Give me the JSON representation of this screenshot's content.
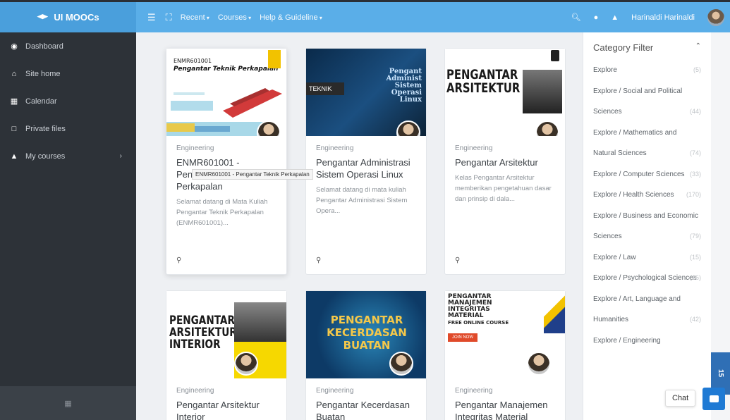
{
  "topbar": {
    "brand": "UI MOOCs",
    "menu": [
      "Recent",
      "Courses",
      "Help & Guideline"
    ],
    "user_name": "Harinaldi Harinaldi"
  },
  "sidebar": {
    "items": [
      {
        "label": "Dashboard",
        "icon": "dashboard-icon"
      },
      {
        "label": "Site home",
        "icon": "home-icon"
      },
      {
        "label": "Calendar",
        "icon": "calendar-icon"
      },
      {
        "label": "Private files",
        "icon": "file-icon"
      },
      {
        "label": "My courses",
        "icon": "graduation-cap-icon"
      }
    ]
  },
  "courses": [
    {
      "category": "Engineering",
      "title": "ENMR601001 - Pengantar Teknik Perkapalan",
      "desc": "Selamat datang di Mata Kuliah Pengantar Teknik Perkapalan (ENMR601001)...",
      "img_code": "ENMR601001",
      "img_title": "Pengantar Teknik Perkapalan"
    },
    {
      "category": "Engineering",
      "title": "Pengantar Administrasi Sistem Operasi Linux",
      "desc": "Selamat datang di mata kuliah Pengantar Administrasi Sistem Opera...",
      "img_label": "TEKNIK",
      "img_title": "Pengant Administ Sistem Operasi Linux"
    },
    {
      "category": "Engineering",
      "title": "Pengantar Arsitektur",
      "desc": "Kelas Pengantar Arsitektur memberikan pengetahuan dasar dan prinsip di dala...",
      "img_title": "PENGANTAR ARSITEKTUR"
    },
    {
      "category": "Engineering",
      "title": "Pengantar Arsitektur Interior",
      "img_title": "PENGANTAR ARSITEKTUR INTERIOR"
    },
    {
      "category": "Engineering",
      "title": "Pengantar Kecerdasan Buatan",
      "img_title": "PENGANTAR KECERDASAN BUATAN"
    },
    {
      "category": "Engineering",
      "title": "Pengantar Manajemen Integritas Material",
      "img_title": "PENGANTAR MANAJEMEN INTEGRITAS MATERIAL",
      "img_subtitle": "FREE ONLINE COURSE",
      "img_button": "JOIN NOW"
    }
  ],
  "tooltip": "ENMR601001 - Pengantar Teknik Perkapalan",
  "filter": {
    "title": "Category Filter",
    "items": [
      {
        "label": "Explore",
        "count": "(5)"
      },
      {
        "label": "Explore / Social and Political Sciences",
        "count": "(44)"
      },
      {
        "label": "Explore / Mathematics and Natural Sciences",
        "count": "(74)"
      },
      {
        "label": "Explore / Computer Sciences",
        "count": "(33)"
      },
      {
        "label": "Explore / Health Sciences",
        "count": "(170)"
      },
      {
        "label": "Explore / Business and Economic Sciences",
        "count": "(79)"
      },
      {
        "label": "Explore / Law",
        "count": "(15)"
      },
      {
        "label": "Explore / Psychological Sciences",
        "count": "(16)"
      },
      {
        "label": "Explore / Art, Language and Humanities",
        "count": "(42)"
      },
      {
        "label": "Explore / Engineering",
        "count": ""
      }
    ]
  },
  "side_tab": "15",
  "chat_label": "Chat"
}
